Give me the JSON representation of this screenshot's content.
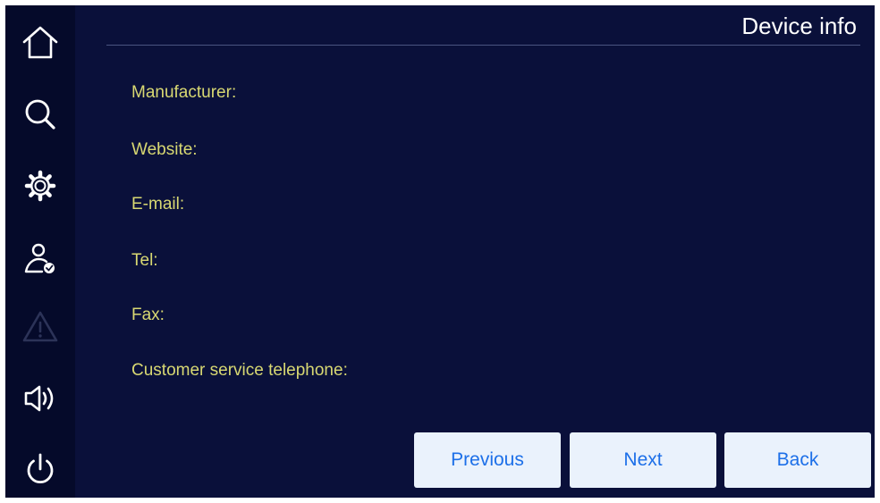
{
  "header": {
    "title": "Device info"
  },
  "sidebar": {
    "items": [
      {
        "icon": "home-icon",
        "enabled": true
      },
      {
        "icon": "search-icon",
        "enabled": true
      },
      {
        "icon": "gear-icon",
        "enabled": true
      },
      {
        "icon": "user-check-icon",
        "enabled": true
      },
      {
        "icon": "warning-icon",
        "enabled": false
      },
      {
        "icon": "speaker-icon",
        "enabled": true
      },
      {
        "icon": "power-icon",
        "enabled": true
      }
    ]
  },
  "fields": {
    "manufacturer": "Manufacturer:",
    "website": "Website:",
    "email": "E-mail:",
    "tel": "Tel:",
    "fax": "Fax:",
    "customer_service": "Customer service telephone:"
  },
  "buttons": {
    "previous": "Previous",
    "next": "Next",
    "back": "Back"
  },
  "colors": {
    "background": "#0a103a",
    "sidebar": "#050a2a",
    "field_label": "#d8d872",
    "button_bg": "#eaf2fc",
    "button_text": "#1c6fe8",
    "disabled_icon": "#2c3358"
  }
}
